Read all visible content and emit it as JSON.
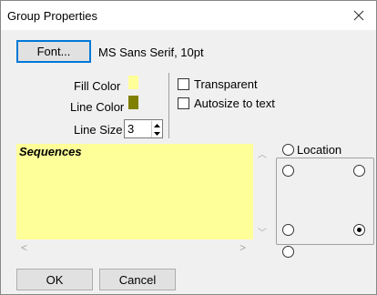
{
  "window": {
    "title": "Group Properties"
  },
  "font": {
    "button_label": "Font...",
    "description": "MS Sans Serif, 10pt"
  },
  "fill_color": {
    "label": "Fill Color",
    "color": "#ffff99"
  },
  "line_color": {
    "label": "Line Color",
    "color": "#808000"
  },
  "line_size": {
    "label": "Line Size",
    "value": "3"
  },
  "options": {
    "transparent_label": "Transparent",
    "transparent_checked": false,
    "autosize_label": "Autosize to text",
    "autosize_checked": false
  },
  "text_area": {
    "content": "Sequences",
    "background": "#ffff99"
  },
  "location": {
    "label": "Location",
    "selected": "bottom-right"
  },
  "buttons": {
    "ok_label": "OK",
    "cancel_label": "Cancel"
  },
  "icons": {
    "close": "close-icon",
    "spin_up": "up-arrow-icon",
    "spin_down": "down-arrow-icon"
  }
}
